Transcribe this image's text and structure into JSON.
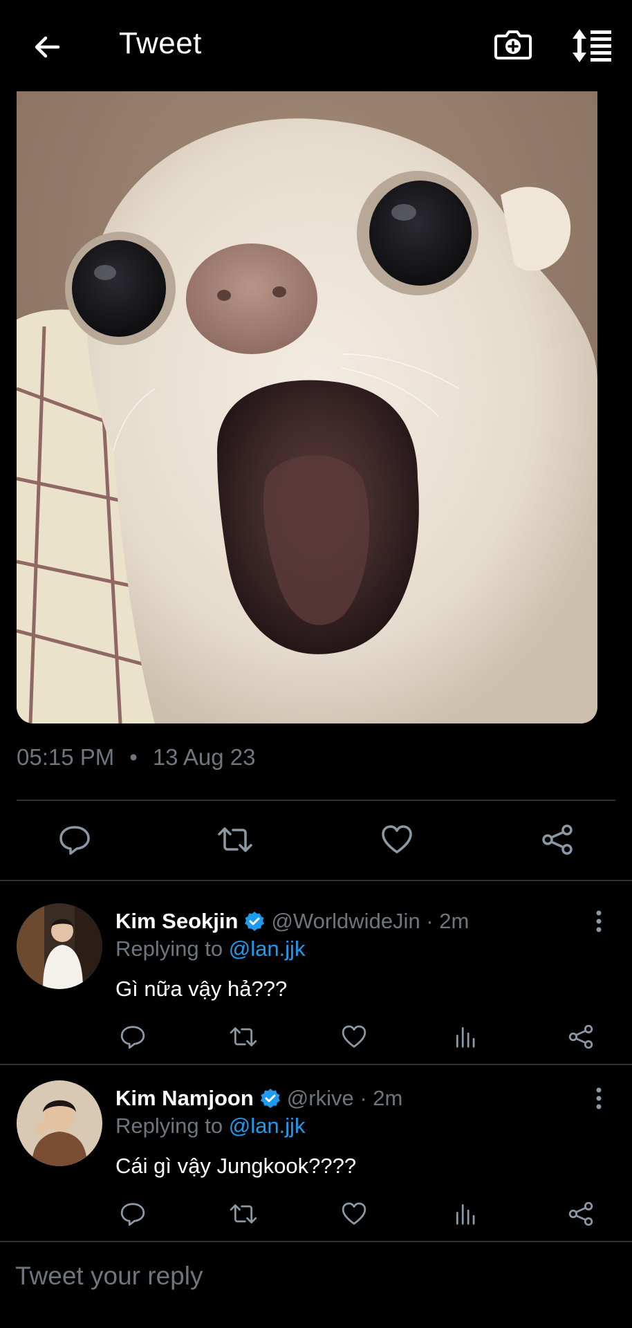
{
  "header": {
    "title": "Tweet",
    "back_icon": "arrow-left-icon",
    "camera_icon": "camera-plus-icon",
    "sort_icon": "sort-list-icon"
  },
  "tweet": {
    "time": "05:15 PM",
    "separator": "•",
    "date": "13 Aug 23",
    "image_subject": "surprised white chihuahua"
  },
  "replies": [
    {
      "name": "Kim Seokjin",
      "handle": "@WorldwideJin · 2m",
      "replying_prefix": "Replying to",
      "replying_to": "@lan.jjk",
      "text": "Gì nữa vậy hả???"
    },
    {
      "name": "Kim Namjoon",
      "handle": "@rkive · 2m",
      "replying_prefix": "Replying to",
      "replying_to": "@lan.jjk",
      "text": "Cái gì vậy Jungkook????"
    }
  ],
  "composer": {
    "placeholder": "Tweet your reply"
  },
  "colors": {
    "background": "#000000",
    "muted": "#6e767d",
    "accent": "#1d9bf0",
    "divider": "#2f3336"
  }
}
